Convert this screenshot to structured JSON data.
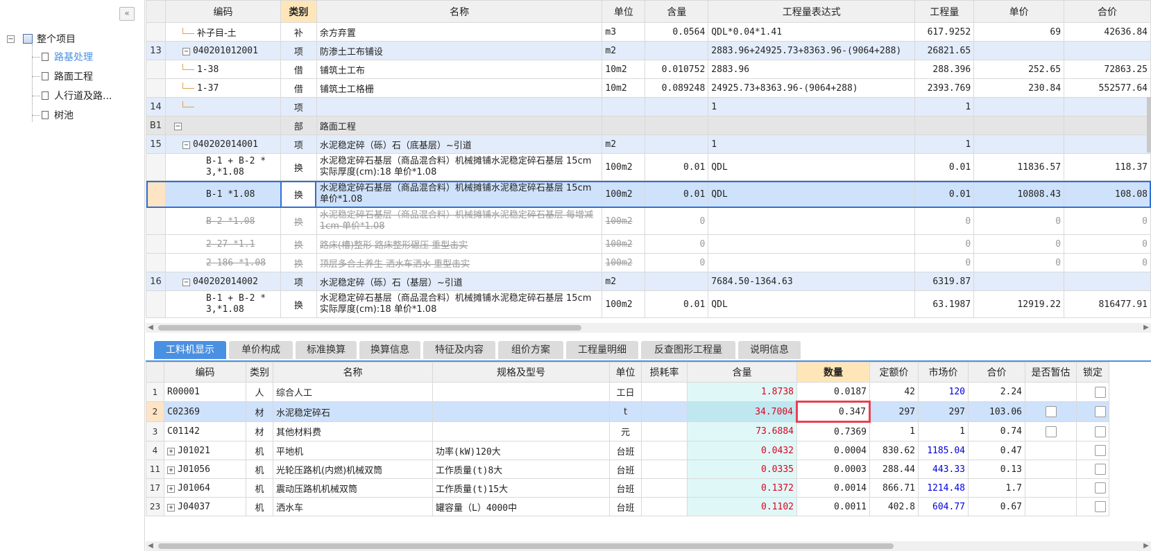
{
  "sidebar": {
    "collapse_icon": "«",
    "root_toggle": "−",
    "root_label": "整个项目",
    "items": [
      {
        "label": "路基处理",
        "active": true
      },
      {
        "label": "路面工程"
      },
      {
        "label": "人行道及路..."
      },
      {
        "label": "树池"
      }
    ]
  },
  "top_table": {
    "headers": [
      "编码",
      "类别",
      "名称",
      "单位",
      "含量",
      "工程量表达式",
      "工程量",
      "单价",
      "合价"
    ],
    "rows": [
      {
        "rn": "",
        "code": "补子目-土",
        "cat": "补",
        "name": "余方弃置",
        "unit": "m3",
        "content": "0.0564",
        "expr": "QDL*0.04*1.41",
        "qty": "617.9252",
        "price": "69",
        "total": "42636.84"
      },
      {
        "rn": "13",
        "code": "040201012001",
        "cat": "项",
        "name": "防渗土工布铺设",
        "unit": "m2",
        "content": "",
        "expr": "2883.96+24925.73+8363.96-(9064+288)",
        "qty": "26821.65",
        "price": "",
        "total": ""
      },
      {
        "rn": "",
        "code": "1-38",
        "cat": "借",
        "name": "铺筑土工布",
        "unit": "10m2",
        "content": "0.010752",
        "expr": "2883.96",
        "qty": "288.396",
        "price": "252.65",
        "total": "72863.25"
      },
      {
        "rn": "",
        "code": "1-37",
        "cat": "借",
        "name": "铺筑土工格栅",
        "unit": "10m2",
        "content": "0.089248",
        "expr": "24925.73+8363.96-(9064+288)",
        "qty": "2393.769",
        "price": "230.84",
        "total": "552577.64"
      },
      {
        "rn": "14",
        "code": "",
        "cat": "项",
        "name": "",
        "unit": "",
        "content": "",
        "expr": "1",
        "qty": "1",
        "price": "",
        "total": ""
      },
      {
        "rn": "B1",
        "code": "",
        "cat": "部",
        "name": "路面工程",
        "unit": "",
        "content": "",
        "expr": "",
        "qty": "",
        "price": "",
        "total": ""
      },
      {
        "rn": "15",
        "code": "040202014001",
        "cat": "项",
        "name": "水泥稳定碎（砾）石（底基层）~引道",
        "unit": "m2",
        "content": "",
        "expr": "1",
        "qty": "1",
        "price": "",
        "total": ""
      },
      {
        "rn": "",
        "code": "B-1 + B-2 * 3,*1.08",
        "cat": "换",
        "name": "水泥稳定碎石基层（商品混合料）机械摊铺水泥稳定碎石基层 15cm  实际厚度(cm):18  单价*1.08",
        "unit": "100m2",
        "content": "0.01",
        "expr": "QDL",
        "qty": "0.01",
        "price": "11836.57",
        "total": "118.37"
      },
      {
        "rn": "",
        "code": "B-1 *1.08",
        "cat": "换",
        "name": "水泥稳定碎石基层（商品混合料）机械摊铺水泥稳定碎石基层 15cm  单价*1.08",
        "unit": "100m2",
        "content": "0.01",
        "expr": "QDL",
        "qty": "0.01",
        "price": "10808.43",
        "total": "108.08"
      },
      {
        "rn": "",
        "code": "B-2 *1.08",
        "cat": "换",
        "name": "水泥稳定碎石基层（商品混合料）机械摊铺水泥稳定碎石基层 每增减1cm  单价*1.08",
        "unit": "100m2",
        "content": "0",
        "expr": "",
        "qty": "0",
        "price": "0",
        "total": "0"
      },
      {
        "rn": "",
        "code": "2-27 *1.1",
        "cat": "换",
        "name": "路床(槽)整形 路床整形碾压  重型击实",
        "unit": "100m2",
        "content": "0",
        "expr": "",
        "qty": "0",
        "price": "0",
        "total": "0"
      },
      {
        "rn": "",
        "code": "2-186 *1.08",
        "cat": "换",
        "name": "顶层多合土养生 洒水车洒水  重型击实",
        "unit": "100m2",
        "content": "0",
        "expr": "",
        "qty": "0",
        "price": "0",
        "total": "0"
      },
      {
        "rn": "16",
        "code": "040202014002",
        "cat": "项",
        "name": "水泥稳定碎（砾）石（基层）~引道",
        "unit": "m2",
        "content": "",
        "expr": "7684.50-1364.63",
        "qty": "6319.87",
        "price": "",
        "total": ""
      },
      {
        "rn": "",
        "code": "B-1 + B-2 * 3,*1.08",
        "cat": "换",
        "name": "水泥稳定碎石基层（商品混合料）机械摊铺水泥稳定碎石基层 15cm  实际厚度(cm):18  单价*1.08",
        "unit": "100m2",
        "content": "0.01",
        "expr": "QDL",
        "qty": "63.1987",
        "price": "12919.22",
        "total": "816477.91"
      }
    ]
  },
  "tabs": [
    "工料机显示",
    "单价构成",
    "标准换算",
    "换算信息",
    "特征及内容",
    "组价方案",
    "工程量明细",
    "反查图形工程量",
    "说明信息"
  ],
  "bottom_table": {
    "headers": [
      "编码",
      "类别",
      "名称",
      "规格及型号",
      "单位",
      "损耗率",
      "含量",
      "数量",
      "定额价",
      "市场价",
      "合价",
      "是否暂估",
      "锁定"
    ],
    "rows": [
      {
        "rn": "1",
        "code": "R00001",
        "cat": "人",
        "name": "综合人工",
        "spec": "",
        "unit": "工日",
        "loss": "",
        "content": "1.8738",
        "qty": "0.0187",
        "base": "42",
        "market": "120",
        "total": "2.24",
        "market_blue": true,
        "checkbox": false
      },
      {
        "rn": "2",
        "code": "C02369",
        "cat": "材",
        "name": "水泥稳定碎石",
        "spec": "",
        "unit": "t",
        "loss": "",
        "content": "34.7004",
        "qty": "0.347",
        "base": "297",
        "market": "297",
        "total": "103.06",
        "market_blue": false,
        "checkbox": true
      },
      {
        "rn": "3",
        "code": "C01142",
        "cat": "材",
        "name": "其他材料费",
        "spec": "",
        "unit": "元",
        "loss": "",
        "content": "73.6884",
        "qty": "0.7369",
        "base": "1",
        "market": "1",
        "total": "0.74",
        "market_blue": false,
        "checkbox": true
      },
      {
        "rn": "4",
        "code": "J01021",
        "cat": "机",
        "name": "平地机",
        "spec": "功率(kW)120大",
        "unit": "台班",
        "loss": "",
        "content": "0.0432",
        "qty": "0.0004",
        "base": "830.62",
        "market": "1185.04",
        "total": "0.47",
        "market_blue": true,
        "checkbox": false
      },
      {
        "rn": "11",
        "code": "J01056",
        "cat": "机",
        "name": "光轮压路机(内燃)机械双筒",
        "spec": "工作质量(t)8大",
        "unit": "台班",
        "loss": "",
        "content": "0.0335",
        "qty": "0.0003",
        "base": "288.44",
        "market": "443.33",
        "total": "0.13",
        "market_blue": true,
        "checkbox": false
      },
      {
        "rn": "17",
        "code": "J01064",
        "cat": "机",
        "name": "震动压路机机械双筒",
        "spec": "工作质量(t)15大",
        "unit": "台班",
        "loss": "",
        "content": "0.1372",
        "qty": "0.0014",
        "base": "866.71",
        "market": "1214.48",
        "total": "1.7",
        "market_blue": true,
        "checkbox": false
      },
      {
        "rn": "23",
        "code": "J04037",
        "cat": "机",
        "name": "洒水车",
        "spec": "罐容量（L）4000中",
        "unit": "台班",
        "loss": "",
        "content": "0.1102",
        "qty": "0.0011",
        "base": "402.8",
        "market": "604.77",
        "total": "0.67",
        "market_blue": true,
        "checkbox": false
      }
    ]
  },
  "colors": {
    "accent": "#4a90e2",
    "highlight_header": "#ffe6b8",
    "red_value": "#e0001b",
    "blue_value": "#0000dd",
    "edit_border": "#e84050"
  }
}
